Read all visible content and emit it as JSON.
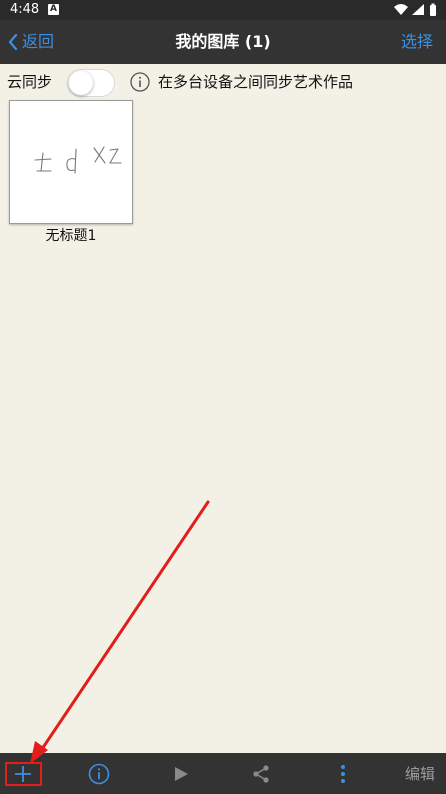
{
  "status_bar": {
    "time": "4:48",
    "notification_badge": "A",
    "icons": [
      "wifi-icon",
      "signal-icon",
      "battery-icon"
    ]
  },
  "nav": {
    "back_label": "返回",
    "title": "我的图库 (1)",
    "select_label": "选择"
  },
  "sync": {
    "label": "云同步",
    "enabled": false,
    "description": "在多台设备之间同步艺术作品"
  },
  "gallery": {
    "items": [
      {
        "name": "无标题1",
        "thumbnail_text": "td xz"
      }
    ]
  },
  "toolbar": {
    "add_icon": "plus-icon",
    "info_icon": "info-icon",
    "play_icon": "play-icon",
    "share_icon": "share-icon",
    "more_icon": "more-vertical-icon",
    "edit_label": "编辑"
  },
  "colors": {
    "accent": "#3d8fe0",
    "bar_background": "#333333",
    "page_background": "#f3f1e6",
    "annotation_red": "#e31c1c"
  }
}
